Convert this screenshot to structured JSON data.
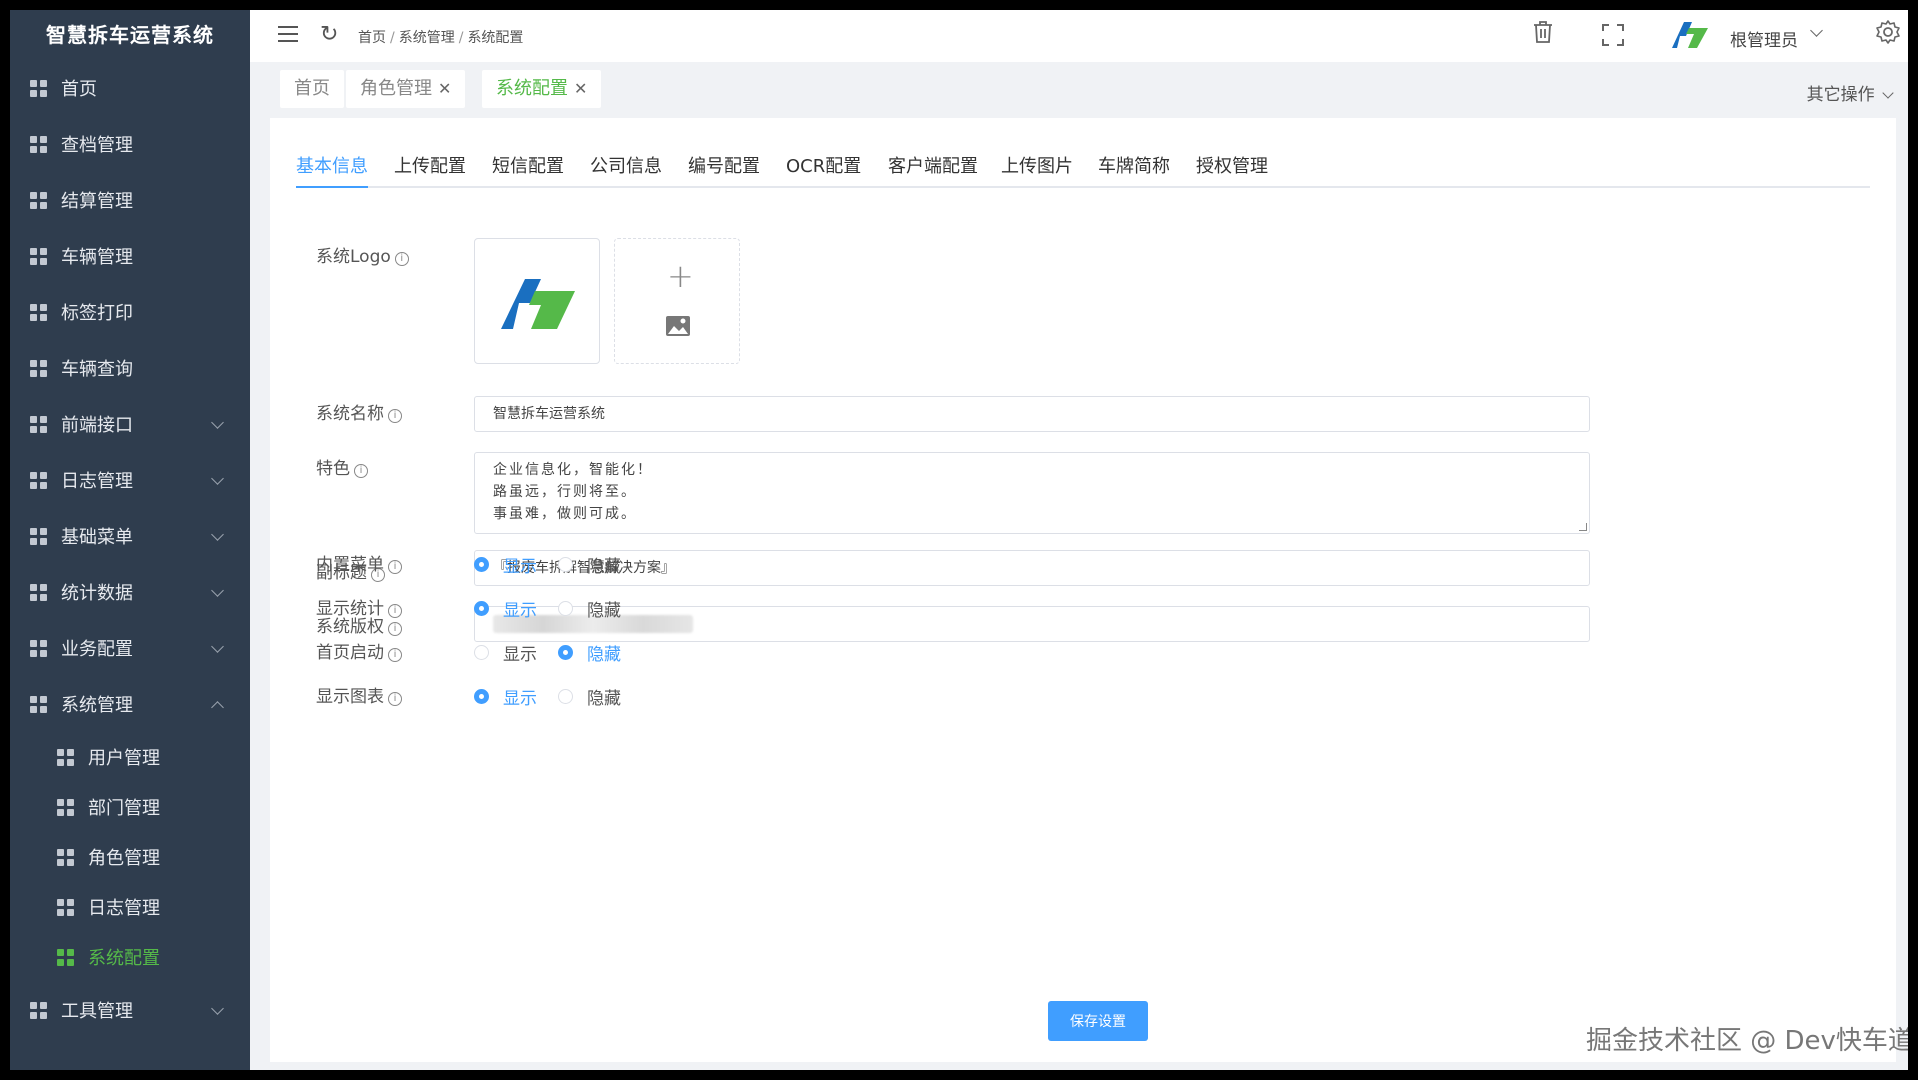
{
  "app": {
    "title": "智慧拆车运营系统"
  },
  "sidebar": {
    "items": [
      {
        "label": "首页",
        "expandable": false
      },
      {
        "label": "查档管理",
        "expandable": false
      },
      {
        "label": "结算管理",
        "expandable": false
      },
      {
        "label": "车辆管理",
        "expandable": false
      },
      {
        "label": "标签打印",
        "expandable": false
      },
      {
        "label": "车辆查询",
        "expandable": false
      },
      {
        "label": "前端接口",
        "expandable": true
      },
      {
        "label": "日志管理",
        "expandable": true
      },
      {
        "label": "基础菜单",
        "expandable": true
      },
      {
        "label": "统计数据",
        "expandable": true
      },
      {
        "label": "业务配置",
        "expandable": true
      },
      {
        "label": "系统管理",
        "expandable": true,
        "expanded": true
      }
    ],
    "sub_items": [
      {
        "label": "用户管理"
      },
      {
        "label": "部门管理"
      },
      {
        "label": "角色管理"
      },
      {
        "label": "日志管理"
      },
      {
        "label": "系统配置",
        "active": true
      }
    ],
    "bottom_item": {
      "label": "工具管理",
      "expandable": true
    }
  },
  "topbar": {
    "breadcrumb": [
      "首页",
      "系统管理",
      "系统配置"
    ],
    "user_name": "根管理员"
  },
  "page_tabs": [
    {
      "label": "首页",
      "closable": false
    },
    {
      "label": "角色管理",
      "closable": true
    },
    {
      "label": "系统配置",
      "closable": true,
      "active": true
    }
  ],
  "other_ops": "其它操作",
  "subtabs": [
    "基本信息",
    "上传配置",
    "短信配置",
    "公司信息",
    "编号配置",
    "OCR配置",
    "客户端配置",
    "上传图片",
    "车牌简称",
    "授权管理"
  ],
  "form": {
    "logo_label": "系统Logo",
    "name_label": "系统名称",
    "name_value": "智慧拆车运营系统",
    "feature_label": "特色",
    "feature_value": "企业信息化，智能化！\n路虽远，行则将至。\n事虽难，做则可成。",
    "subtitle_label": "副标题",
    "subtitle_value": "『报废车拆解智慧解决方案』",
    "copyright_label": "系统版权",
    "builtin_menu_label": "内置菜单",
    "show_stats_label": "显示统计",
    "home_start_label": "首页启动",
    "show_chart_label": "显示图表",
    "show_text": "显示",
    "hide_text": "隐藏",
    "builtin_menu": "show",
    "show_stats": "show",
    "home_start": "hide",
    "show_chart": "show"
  },
  "save_label": "保存设置",
  "watermark": "掘金技术社区 @ Dev快车道",
  "colors": {
    "sidebar": "#2f3d4e",
    "accent": "#409eff",
    "active_green": "#55b949",
    "logo_blue": "#1a6fc0",
    "logo_green": "#55b949"
  }
}
